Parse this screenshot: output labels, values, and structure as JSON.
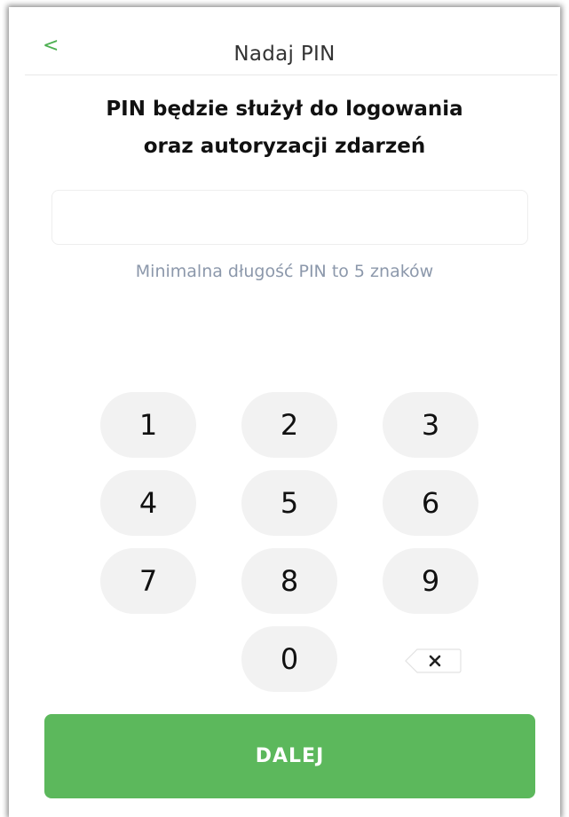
{
  "header": {
    "back_label": "<",
    "title": "Nadaj PIN"
  },
  "main": {
    "heading_line1": "PIN będzie służył do logowania",
    "heading_line2": "oraz autoryzacji zdarzeń",
    "pin_value": "",
    "hint": "Minimalna długość PIN to 5 znaków"
  },
  "keypad": {
    "keys": [
      "1",
      "2",
      "3",
      "4",
      "5",
      "6",
      "7",
      "8",
      "9",
      "0"
    ],
    "backspace_icon": "backspace-icon"
  },
  "actions": {
    "next_label": "DALEJ"
  },
  "colors": {
    "accent": "#5cb85c",
    "key_background": "#f2f2f2",
    "hint_text": "#8c98ab"
  }
}
